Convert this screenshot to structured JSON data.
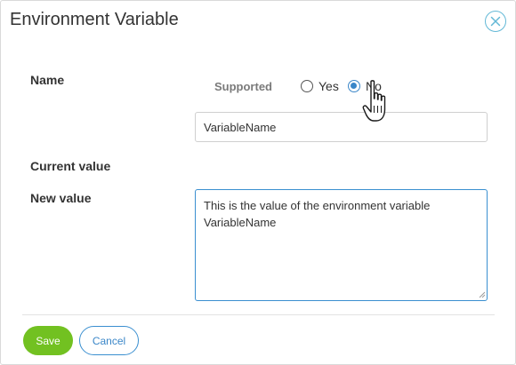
{
  "dialog": {
    "title": "Environment Variable"
  },
  "form": {
    "name_label": "Name",
    "supported_label": "Supported",
    "supported_options": [
      {
        "label": "Yes",
        "checked": false
      },
      {
        "label": "No",
        "checked": true
      }
    ],
    "name_value": "VariableName",
    "current_value_label": "Current value",
    "new_value_label": "New value",
    "new_value": "This is the value of the environment variable VariableName"
  },
  "footer": {
    "save_label": "Save",
    "cancel_label": "Cancel"
  },
  "colors": {
    "accent": "#3a86c8",
    "save_green": "#72c121",
    "close_icon": "#62b8d6"
  },
  "icons": {
    "close": "close-icon",
    "pointer": "hand-pointer-icon"
  }
}
